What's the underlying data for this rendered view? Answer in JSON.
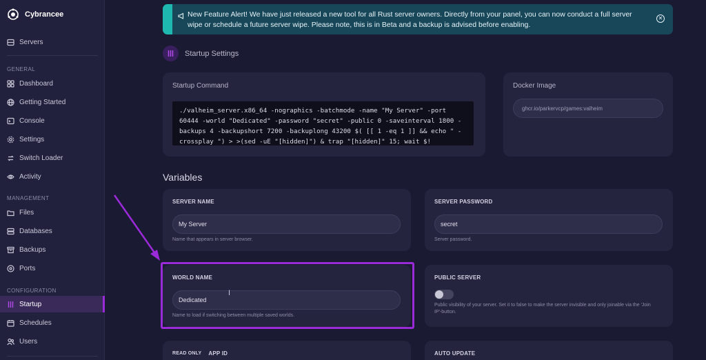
{
  "brand": {
    "name": "Cybrancee"
  },
  "sidebar": {
    "top_item": {
      "label": "Servers",
      "icon": "server-icon"
    },
    "sections": [
      {
        "title": "GENERAL",
        "items": [
          {
            "label": "Dashboard",
            "icon": "dashboard-icon"
          },
          {
            "label": "Getting Started",
            "icon": "globe-icon"
          },
          {
            "label": "Console",
            "icon": "terminal-icon"
          },
          {
            "label": "Settings",
            "icon": "gear-icon"
          },
          {
            "label": "Switch Loader",
            "icon": "switch-icon"
          },
          {
            "label": "Activity",
            "icon": "eye-icon"
          }
        ]
      },
      {
        "title": "MANAGEMENT",
        "items": [
          {
            "label": "Files",
            "icon": "folder-icon"
          },
          {
            "label": "Databases",
            "icon": "database-icon"
          },
          {
            "label": "Backups",
            "icon": "archive-icon"
          },
          {
            "label": "Ports",
            "icon": "network-icon"
          }
        ]
      },
      {
        "title": "CONFIGURATION",
        "items": [
          {
            "label": "Startup",
            "icon": "sliders-icon",
            "active": true
          },
          {
            "label": "Schedules",
            "icon": "calendar-icon"
          },
          {
            "label": "Users",
            "icon": "users-icon"
          }
        ]
      }
    ]
  },
  "alert": {
    "text": "New Feature Alert! We have just released a new tool for all Rust server owners. Directly from your panel, you can now conduct a full server wipe or schedule a future server wipe. Please note, this is in Beta and a backup is advised before enabling."
  },
  "startup": {
    "title": "Startup Settings",
    "command_title": "Startup Command",
    "command": "./valheim_server.x86_64 -nographics -batchmode -name \"My Server\" -port 60444 -world \"Dedicated\" -password \"secret\" -public 0 -saveinterval 1800 -backups 4 -backupshort 7200 -backuplong 43200 $( [[ 1 -eq 1 ]] && echo \" -crossplay \") > >(sed -uE \"[hidden]\") & trap \"[hidden]\" 15; wait $!",
    "docker_title": "Docker Image",
    "docker_image": "ghcr.io/parkervcp/games:valheim"
  },
  "variables": {
    "title": "Variables",
    "server_name": {
      "label": "SERVER NAME",
      "value": "My Server",
      "help": "Name that appears in server browser."
    },
    "server_password": {
      "label": "SERVER PASSWORD",
      "value": "secret",
      "help": "Server password."
    },
    "world_name": {
      "label": "WORLD NAME",
      "value": "Dedicated",
      "help": "Name to load if switching between multiple saved worlds."
    },
    "public_server": {
      "label": "PUBLIC SERVER",
      "enabled": false,
      "help": "Public visibility of your server. Set it to false to make the server invisible and only joinable via the 'Join IP'-button."
    },
    "app_id": {
      "readonly_tag": "READ ONLY",
      "label": "APP ID"
    },
    "auto_update": {
      "label": "AUTO UPDATE"
    }
  },
  "colors": {
    "accent": "#9b2ad8",
    "background": "#1b1a33",
    "card": "#25243f",
    "alert": "#19475a",
    "alert_bar": "#1fb8b0"
  }
}
